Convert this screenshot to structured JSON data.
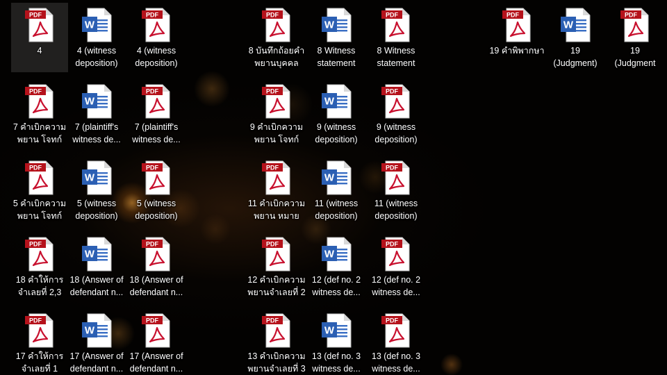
{
  "desktop": {
    "columns": [
      {
        "icons": [
          {
            "type": "pdf",
            "label": "4",
            "selected": true
          },
          {
            "type": "pdf",
            "label": "7 คำเบิกความ\nพยาน โจทก์"
          },
          {
            "type": "pdf",
            "label": "5 คำเบิกความ\nพยาน โจทก์"
          },
          {
            "type": "pdf",
            "label": "18 คำให้การ\nจำเลยที่ 2,3"
          },
          {
            "type": "pdf",
            "label": "17 คำให้การ\nจำเลยที่ 1"
          }
        ]
      },
      {
        "icons": [
          {
            "type": "word",
            "label": "4 (witness\ndeposition)"
          },
          {
            "type": "word",
            "label": "7 (plaintiff's\nwitness de..."
          },
          {
            "type": "word",
            "label": "5 (witness\ndeposition)"
          },
          {
            "type": "word",
            "label": "18 (Answer of\ndefendant n..."
          },
          {
            "type": "word",
            "label": "17 (Answer of\ndefendant n..."
          }
        ]
      },
      {
        "icons": [
          {
            "type": "pdf",
            "label": "4 (witness\ndeposition)"
          },
          {
            "type": "pdf",
            "label": "7 (plaintiff's\nwitness de..."
          },
          {
            "type": "pdf",
            "label": "5 (witness\ndeposition)"
          },
          {
            "type": "pdf",
            "label": "18 (Answer of\ndefendant n..."
          },
          {
            "type": "pdf",
            "label": "17 (Answer of\ndefendant n..."
          }
        ]
      },
      {
        "icons": [
          {
            "type": "pdf",
            "label": "8 บันทึกถ้อยคำ\nพยานบุคคล"
          },
          {
            "type": "pdf",
            "label": "9 คำเบิกความ\nพยาน โจทก์"
          },
          {
            "type": "pdf",
            "label": "11 คำเบิกความ\nพยาน หมาย"
          },
          {
            "type": "pdf",
            "label": "12 คำเบิกความ\nพยานจำเลยที่ 2"
          },
          {
            "type": "pdf",
            "label": "13 คำเบิกความ\nพยานจำเลยที่ 3"
          }
        ]
      },
      {
        "icons": [
          {
            "type": "word",
            "label": "8 Witness\nstatement"
          },
          {
            "type": "word",
            "label": "9 (witness\ndeposition)"
          },
          {
            "type": "word",
            "label": "11 (witness\ndeposition)"
          },
          {
            "type": "word",
            "label": "12 (def no. 2\nwitness de..."
          },
          {
            "type": "word",
            "label": "13 (def no. 3\nwitness de..."
          }
        ]
      },
      {
        "icons": [
          {
            "type": "pdf",
            "label": "8 Witness\nstatement"
          },
          {
            "type": "pdf",
            "label": "9 (witness\ndeposition)"
          },
          {
            "type": "pdf",
            "label": "11 (witness\ndeposition)"
          },
          {
            "type": "pdf",
            "label": "12 (def no. 2\nwitness de..."
          },
          {
            "type": "pdf",
            "label": "13 (def no. 3\nwitness de..."
          }
        ]
      },
      {
        "icons": [
          {
            "type": "pdf",
            "label": "19 คำพิพากษา"
          }
        ]
      },
      {
        "icons": [
          {
            "type": "word",
            "label": "19\n(Judgment)"
          }
        ]
      },
      {
        "icons": [
          {
            "type": "pdf",
            "label": "19\n(Judgment"
          }
        ]
      }
    ]
  },
  "icon_badges": {
    "pdf": "PDF",
    "word": "W"
  },
  "colors": {
    "pdf_red": "#c8102e",
    "pdf_badge": "#b5121b",
    "word_blue": "#2b5fb3",
    "word_lines": "#3a6fc4",
    "label_text": "#ffffff"
  },
  "icon_names": {
    "pdf": "pdf-file-icon",
    "word": "word-file-icon"
  }
}
